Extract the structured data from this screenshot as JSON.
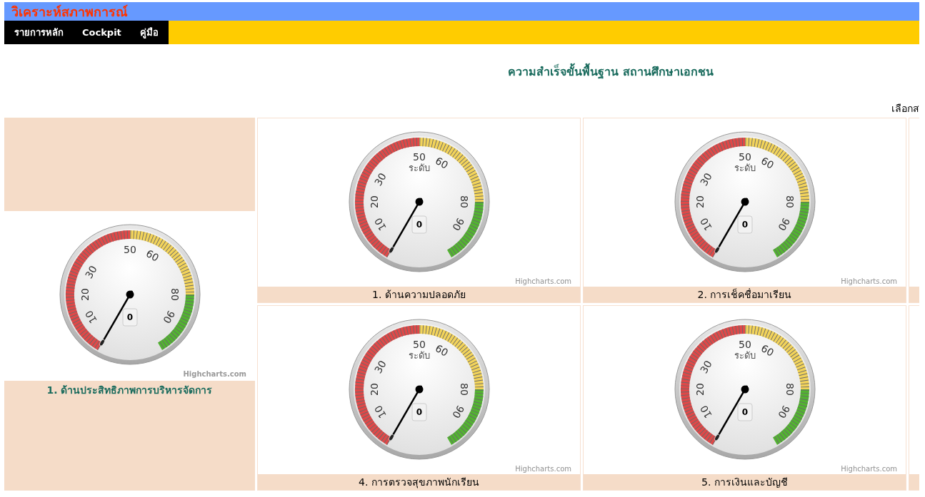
{
  "header": {
    "title": "วิเคราะห์สภาพการณ์"
  },
  "nav": [
    {
      "label": "รายการหลัก"
    },
    {
      "label": "Cockpit"
    },
    {
      "label": "คู่มือ"
    }
  ],
  "page_title": "ความสำเร็จขั้นพื้นฐาน สถานศึกษาเอกชน",
  "selector_label": "เลือกส",
  "summary": {
    "gauge": {
      "scale_labels": [
        "10",
        "20",
        "30",
        "50",
        "60",
        "80",
        "90"
      ],
      "value": "0",
      "credit": "Highcharts.com"
    },
    "label": "1. ด้านประสิทธิภาพการบริหารจัดการ"
  },
  "cards": [
    {
      "gauge": {
        "scale_labels": [
          "10",
          "20",
          "30",
          "50",
          "60",
          "80",
          "90"
        ],
        "axis_title": "ระดับ",
        "value": "0",
        "credit": "Highcharts.com"
      },
      "label": "1. ด้านความปลอดภัย"
    },
    {
      "gauge": {
        "scale_labels": [
          "10",
          "20",
          "30",
          "50",
          "60",
          "80",
          "90"
        ],
        "axis_title": "ระดับ",
        "value": "0",
        "credit": "Highcharts.com"
      },
      "label": "2. การเช็คชื่อมาเรียน"
    },
    {
      "gauge": {
        "scale_labels": [
          "10",
          "20",
          "30",
          "50",
          "60",
          "80",
          "90"
        ],
        "axis_title": "ระดับ",
        "value": "0",
        "credit": "Highcharts.com"
      },
      "label": "4. การตรวจสุขภาพนักเรียน"
    },
    {
      "gauge": {
        "scale_labels": [
          "10",
          "20",
          "30",
          "50",
          "60",
          "80",
          "90"
        ],
        "axis_title": "ระดับ",
        "value": "0",
        "credit": "Highcharts.com"
      },
      "label": "5. การเงินและบัญชี"
    }
  ]
}
